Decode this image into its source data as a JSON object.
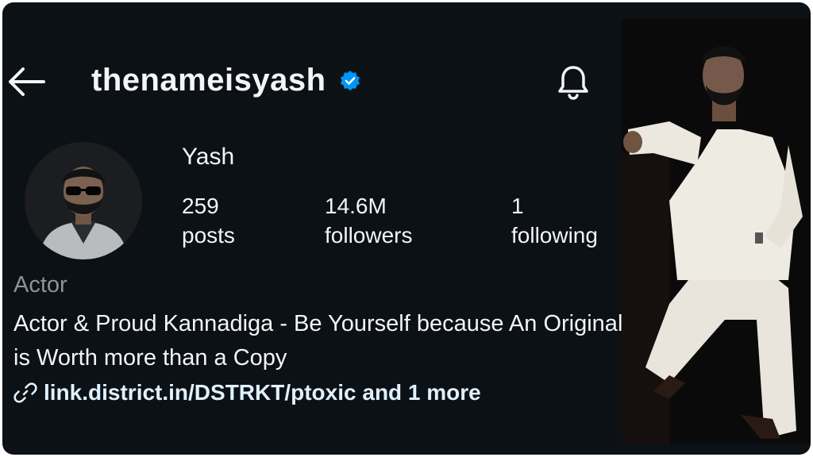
{
  "header": {
    "username": "thenameisyash",
    "back_icon": "arrow-left-icon",
    "verified_icon": "verified-badge-icon",
    "notification_icon": "bell-icon"
  },
  "profile": {
    "display_name": "Yash",
    "stats": [
      {
        "value": "259",
        "label": "posts"
      },
      {
        "value": "14.6M",
        "label": "followers"
      },
      {
        "value": "1",
        "label": "following"
      }
    ],
    "category": "Actor",
    "bio": "Actor & Proud Kannadiga - Be Yourself because An Original is Worth more than a Copy",
    "link_icon": "link-icon",
    "link": "link.district.in/DSTRKT/ptoxic and 1 more"
  },
  "colors": {
    "background": "#0c1116",
    "text": "#f3f5f7",
    "muted": "#8e9399",
    "verified": "#0095f6",
    "link": "#e0f1ff"
  }
}
